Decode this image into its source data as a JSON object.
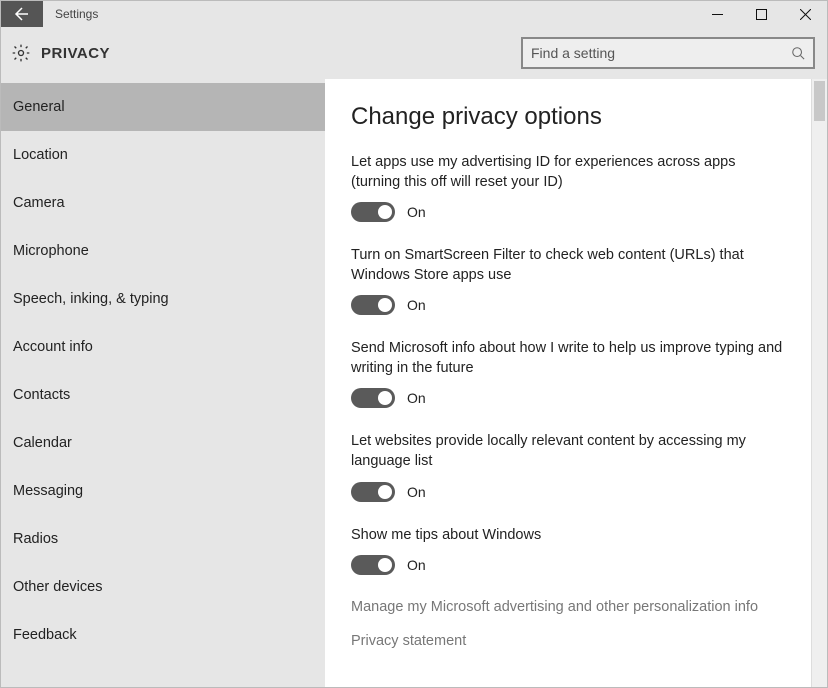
{
  "titlebar": {
    "app_title": "Settings"
  },
  "header": {
    "title": "PRIVACY"
  },
  "search": {
    "placeholder": "Find a setting"
  },
  "sidebar": {
    "items": [
      {
        "label": "General",
        "selected": true
      },
      {
        "label": "Location"
      },
      {
        "label": "Camera"
      },
      {
        "label": "Microphone"
      },
      {
        "label": "Speech, inking, & typing"
      },
      {
        "label": "Account info"
      },
      {
        "label": "Contacts"
      },
      {
        "label": "Calendar"
      },
      {
        "label": "Messaging"
      },
      {
        "label": "Radios"
      },
      {
        "label": "Other devices"
      },
      {
        "label": "Feedback"
      }
    ]
  },
  "content": {
    "heading": "Change privacy options",
    "options": [
      {
        "label": "Let apps use my advertising ID for experiences across apps (turning this off will reset your ID)",
        "state": "On"
      },
      {
        "label": "Turn on SmartScreen Filter to check web content (URLs) that Windows Store apps use",
        "state": "On"
      },
      {
        "label": "Send Microsoft info about how I write to help us improve typing and writing in the future",
        "state": "On"
      },
      {
        "label": "Let websites provide locally relevant content by accessing my language list",
        "state": "On"
      },
      {
        "label": "Show me tips about Windows",
        "state": "On"
      }
    ],
    "links": [
      "Manage my Microsoft advertising and other personalization info",
      "Privacy statement"
    ]
  }
}
